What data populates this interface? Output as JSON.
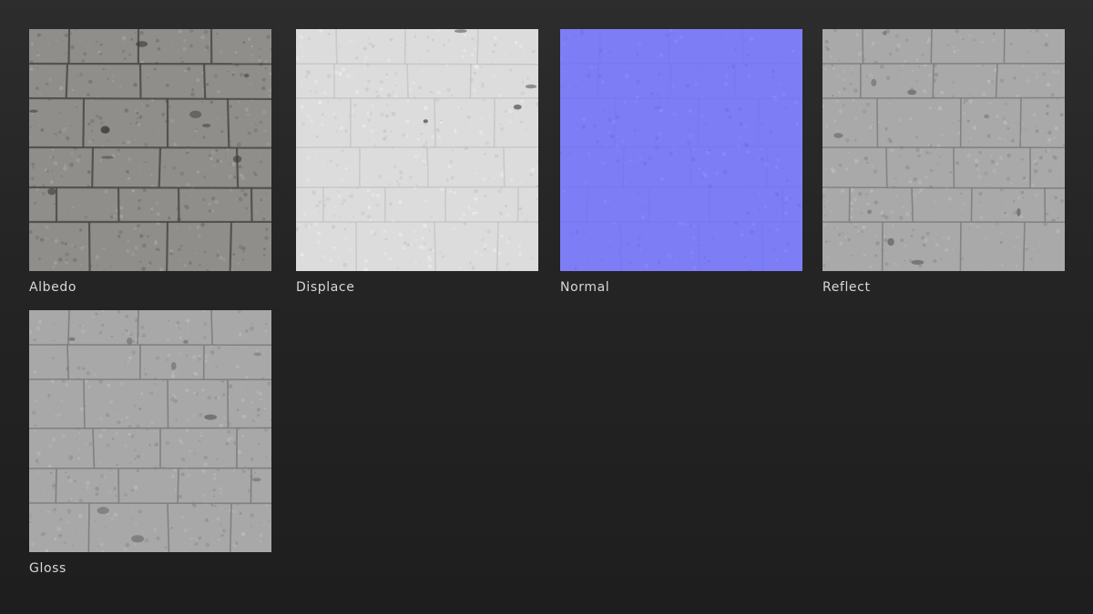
{
  "maps": [
    {
      "label": "Albedo",
      "kind": "albedo",
      "base": "#8f8e8a",
      "mortar": "#4a4946",
      "stain": "#3a3936"
    },
    {
      "label": "Displace",
      "kind": "displace",
      "base": "#dcdcdc",
      "mortar": "#bdbdbd",
      "stain": "#4f4f4f"
    },
    {
      "label": "Normal",
      "kind": "normal",
      "base": "#7d7ef6",
      "mortar": "#7273e8",
      "stain": "#6e70e2"
    },
    {
      "label": "Reflect",
      "kind": "reflect",
      "base": "#a9a9a9",
      "mortar": "#7c7c7c",
      "stain": "#6a6a6a"
    },
    {
      "label": "Gloss",
      "kind": "gloss",
      "base": "#a8a8a8",
      "mortar": "#7a7a7a",
      "stain": "#6a6a6a"
    }
  ]
}
